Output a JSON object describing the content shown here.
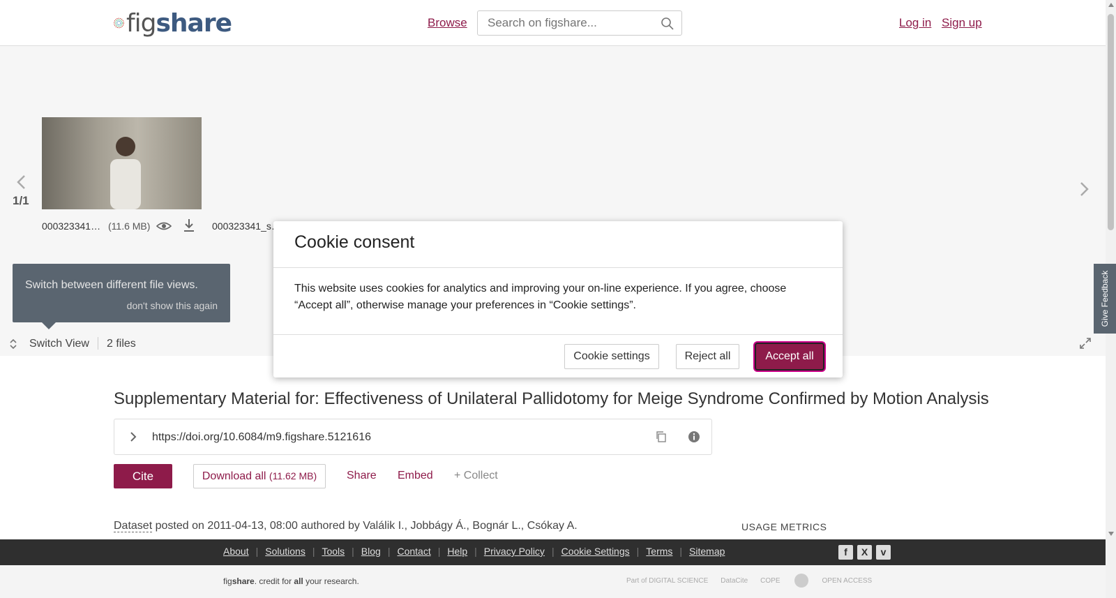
{
  "header": {
    "logo_text_a": "fig",
    "logo_text_b": "share",
    "browse": "Browse",
    "search_placeholder": "Search on figshare...",
    "login": "Log in",
    "signup": "Sign up"
  },
  "viewer": {
    "page_count": "1/1",
    "file1_name": "000323341…",
    "file1_size": "(11.6 MB)",
    "file2_name": "000323341_s…",
    "tooltip_text": "Switch between different file views.",
    "tooltip_dismiss": "don't show this again",
    "switch_view": "Switch View",
    "files_count": "2 files"
  },
  "feedback": "Give Feedback",
  "modal": {
    "title": "Cookie consent",
    "body": "This website uses cookies for analytics and improving your on-line experience. If you agree, choose “Accept all”, otherwise manage your preferences in “Cookie settings”.",
    "btn_settings": "Cookie settings",
    "btn_reject": "Reject all",
    "btn_accept": "Accept all"
  },
  "article": {
    "title": "Supplementary Material for: Effectiveness of Unilateral Pallidotomy for Meige Syndrome Confirmed by Motion Analysis",
    "doi": "https://doi.org/10.6084/m9.figshare.5121616",
    "cite": "Cite",
    "download_label": "Download all",
    "download_size": "(11.62 MB)",
    "share": "Share",
    "embed": "Embed",
    "collect": "+ Collect",
    "dataset_type": "Dataset",
    "posted_text": " posted on 2011-04-13, 08:00 authored by Valálik I., Jobbágy Á., Bognár L., Csókay A.",
    "usage_metrics": "USAGE METRICS"
  },
  "footer": {
    "links": [
      "About",
      "Solutions",
      "Tools",
      "Blog",
      "Contact",
      "Help",
      "Privacy Policy",
      "Cookie Settings",
      "Terms",
      "Sitemap"
    ],
    "credit_a": "fig",
    "credit_b": "share",
    "credit_c": ". credit for ",
    "credit_d": "all",
    "credit_e": " your research.",
    "partner_1": "Part of DIGITAL SCIENCE",
    "partner_2": "DataCite",
    "partner_3": "COPE",
    "partner_4": "",
    "partner_5": "OPEN ACCESS"
  },
  "colors": {
    "brand": "#8e1b4a",
    "footer_bg": "#2f2f2f"
  }
}
